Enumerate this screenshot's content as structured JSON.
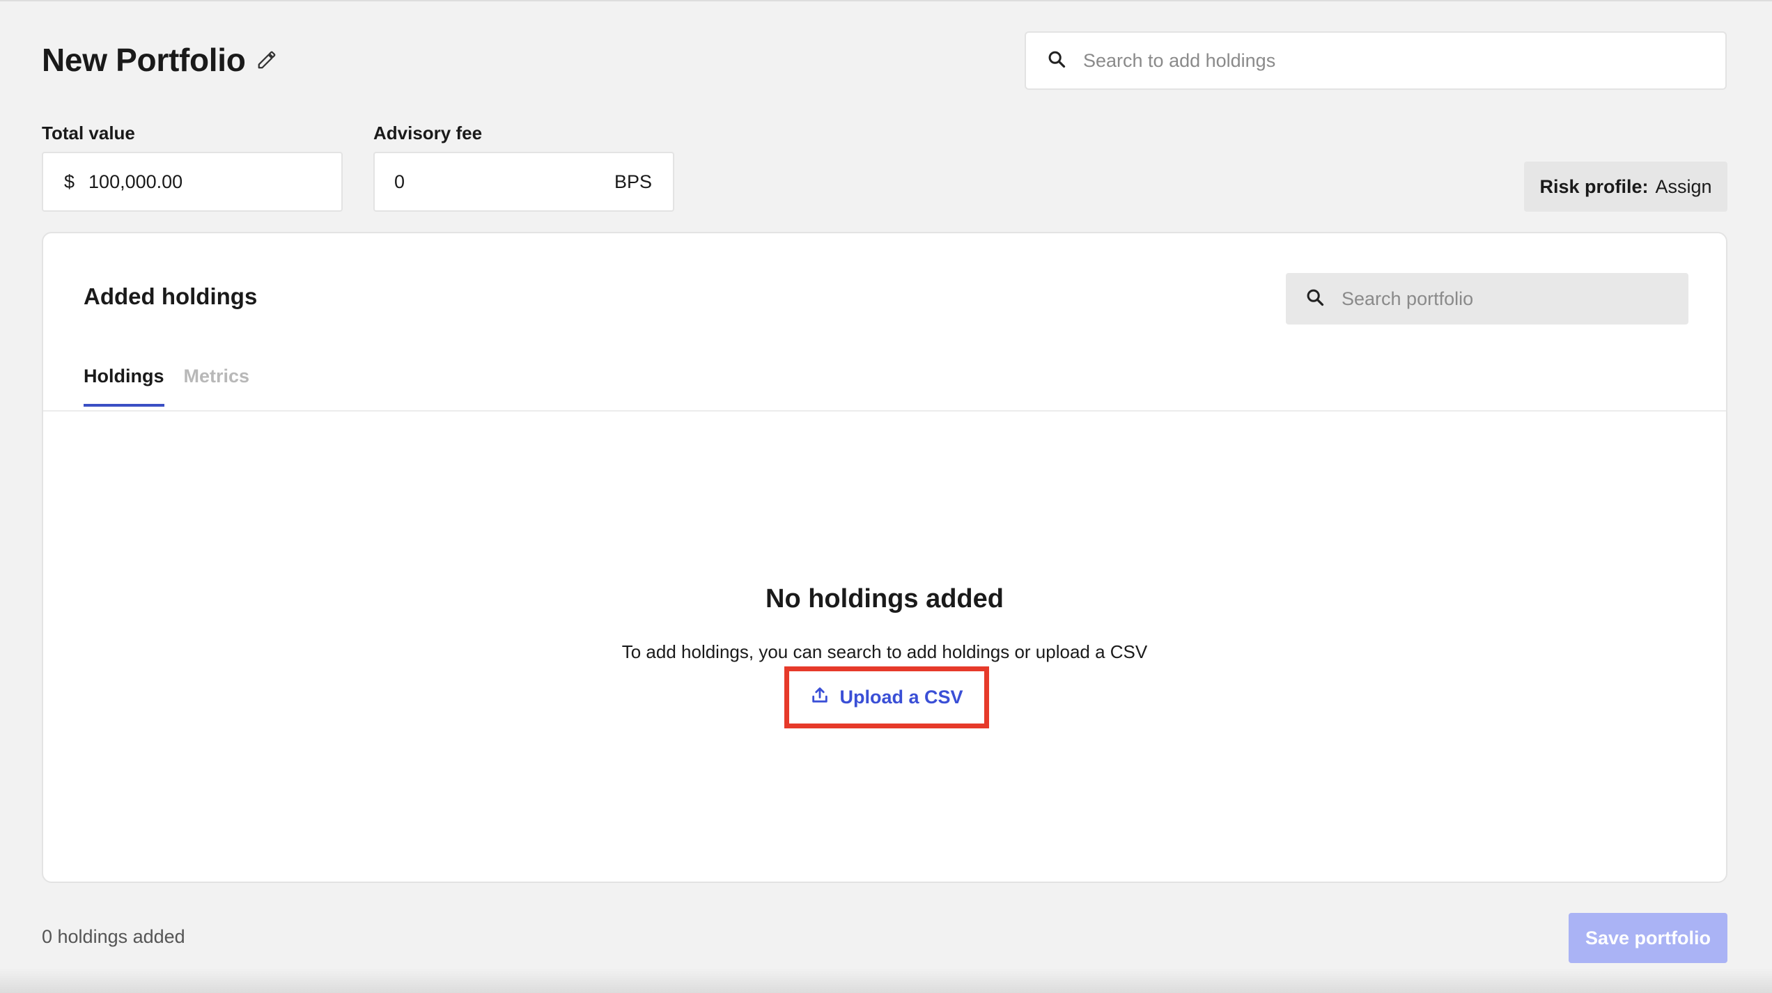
{
  "header": {
    "title": "New Portfolio",
    "edit_icon": "pencil-icon"
  },
  "holdings_search": {
    "placeholder": "Search to add holdings",
    "icon": "search-icon"
  },
  "total_value": {
    "label": "Total value",
    "currency": "$",
    "value": "100,000.00"
  },
  "advisory_fee": {
    "label": "Advisory fee",
    "value": "0",
    "unit": "BPS"
  },
  "risk_profile": {
    "key": "Risk profile:",
    "value": "Assign"
  },
  "card": {
    "title": "Added holdings",
    "search": {
      "placeholder": "Search portfolio",
      "icon": "search-icon"
    },
    "tabs": [
      {
        "label": "Holdings",
        "active": true
      },
      {
        "label": "Metrics",
        "active": false
      }
    ],
    "empty_state": {
      "title": "No holdings added",
      "description": "To add holdings, you can search to add holdings or upload a CSV",
      "upload_label": "Upload a CSV",
      "upload_icon": "upload-icon"
    }
  },
  "footer": {
    "holdings_count": "0 holdings added",
    "save_label": "Save portfolio"
  },
  "colors": {
    "accent": "#3a4fd6",
    "tab_underline": "#3a4fc4",
    "highlight": "#e63a2a",
    "save_disabled": "#aab3f5",
    "background": "#f2f2f2"
  }
}
